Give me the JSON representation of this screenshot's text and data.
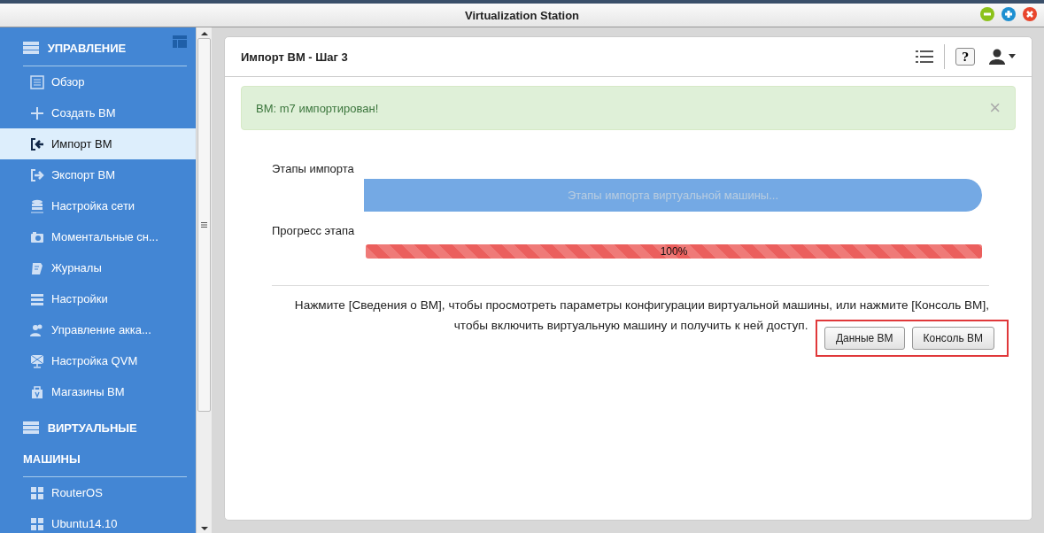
{
  "window": {
    "title": "Virtualization Station"
  },
  "sidebar": {
    "sections": [
      {
        "title_lines": [
          "УПРАВЛЕНИЕ"
        ],
        "items": [
          {
            "label": "Обзор",
            "selected": false
          },
          {
            "label": "Создать ВМ",
            "selected": false
          },
          {
            "label": "Импорт ВМ",
            "selected": true
          },
          {
            "label": "Экспорт ВМ",
            "selected": false
          },
          {
            "label": "Настройка сети",
            "selected": false
          },
          {
            "label": "Моментальные сн...",
            "selected": false
          },
          {
            "label": "Журналы",
            "selected": false
          },
          {
            "label": "Настройки",
            "selected": false
          },
          {
            "label": "Управление акка...",
            "selected": false
          },
          {
            "label": "Настройка QVM",
            "selected": false
          },
          {
            "label": "Магазины ВМ",
            "selected": false
          }
        ]
      },
      {
        "title_lines": [
          "ВИРТУАЛЬНЫЕ",
          "МАШИНЫ"
        ],
        "items": [
          {
            "label": "RouterOS",
            "selected": false
          },
          {
            "label": "Ubuntu14.10",
            "selected": false
          }
        ]
      }
    ]
  },
  "panel": {
    "title": "Импорт ВМ - Шаг 3",
    "help": "?",
    "alert": {
      "message": "ВМ: m7 импортирован!",
      "close": "×"
    },
    "stages": {
      "label": "Этапы импорта",
      "bar_text": "Этапы импорта виртуальной машины...",
      "level": 1
    },
    "progress": {
      "label": "Прогресс этапа",
      "level": 1,
      "reading": "100%"
    },
    "instructions": "Нажмите [Сведения о ВМ], чтобы просмотреть параметры конфигурации виртуальной машины, или нажмите [Консоль ВМ], чтобы включить виртуальную машину и получить к ней доступ.",
    "buttons": [
      "Данные ВМ",
      "Консоль ВМ"
    ],
    "buttons_highlighted": true
  }
}
